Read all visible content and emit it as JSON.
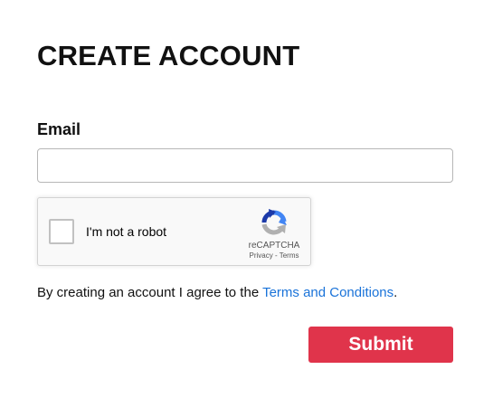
{
  "page": {
    "title": "CREATE ACCOUNT"
  },
  "form": {
    "email_label": "Email",
    "email_value": "",
    "email_placeholder": "",
    "submit_label": "Submit"
  },
  "recaptcha": {
    "checkbox_checked": false,
    "label": "I'm not a robot",
    "brand": "reCAPTCHA",
    "privacy_label": "Privacy",
    "separator": " - ",
    "terms_label": "Terms",
    "logo_icon": "recaptcha-logo-icon"
  },
  "agreement": {
    "prefix": "By creating an account I agree to the ",
    "link_label": "Terms and Conditions",
    "suffix": "."
  },
  "colors": {
    "submit_bg": "#e0344b",
    "link": "#1a73d9",
    "recaptcha_blue_dark": "#1c3aa9",
    "recaptcha_blue": "#4285f4",
    "recaptcha_gray": "#b0b0b0"
  }
}
